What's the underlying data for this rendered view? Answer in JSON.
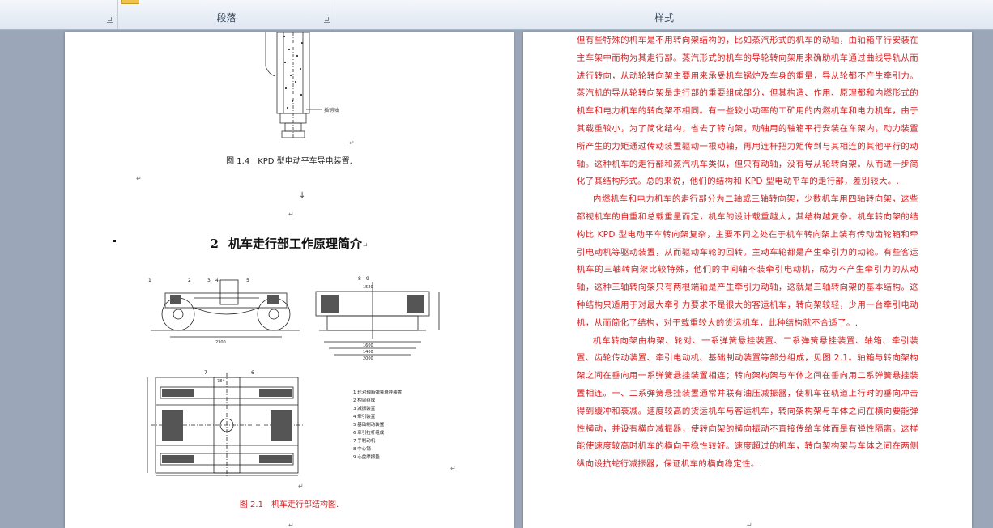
{
  "ribbon": {
    "paragraph_group": "段落",
    "styles_group": "样式"
  },
  "left_page": {
    "fig14_label": "插销轴",
    "fig14_caption": "图 1.4　KPD 型电动平车导电装置.",
    "heading_number": "2",
    "heading_text": "机车走行部工作原理简介",
    "fig21_caption": "图 2.1　机车走行部结构图.",
    "fig21_legend": [
      "1  轮对轴箱弹簧悬挂装置",
      "2  构架组成",
      "3  减振装置",
      "4  牵引装置",
      "5  基础制动装置",
      "6  牵引拉杆组成",
      "7  手制动机",
      "8  中心销",
      "9  心盘摩擦垫"
    ],
    "fig21_numbers": [
      "1",
      "2",
      "3",
      "4",
      "5",
      "7",
      "6",
      "8",
      "9"
    ],
    "fig21_dimensions": [
      "2300",
      "1520",
      "1600",
      "2000",
      "784",
      "1400"
    ]
  },
  "right_page": {
    "paragraphs": [
      "但有些特殊的机车是不用转向架结构的，比如蒸汽形式的机车的动轴，由轴箱平行安装在主车架中而构为其走行部。蒸汽形式的机车的导轮转向架用来确助机车通过曲线导轨从而进行转向，从动轮转向架主要用来承受机车锅炉及车身的重量，导从轮都不产生牵引力。蒸汽机的导从轮转向架是走行部的重要组成部分，但其构造、作用、原理都和内燃形式的机车和电力机车的转向架不相同。有一些较小功率的工矿用的内燃机车和电力机车，由于其载重较小，为了简化结构，省去了转向架，动轴用的轴箱平行安装在车架内，动力装置所产生的力矩通过传动装置驱动一根动轴，再用连杆把力矩传到与其相连的其他平行的动轴。这种机车的走行部和蒸汽机车类似，但只有动轴，没有导从轮转向架。从而进一步简化了其结构形式。总的来说，他们的结构和 KPD 型电动平车的走行部，差别较大。.",
      "内燃机车和电力机车的走行部分为二轴或三轴转向架，少数机车用四轴转向架，这些都视机车的自重和总载重量而定，机车的设计载重越大，其结构越复杂。机车转向架的结构比 KPD 型电动平车转向架复杂，主要不同之处在于机车转向架上装有传动齿轮箱和牵引电动机等驱动装置，从而驱动车轮的回转。主动车轮都是产生牵引力的动轮。有些客运机车的三轴转向架比较特殊，他们的中间轴不装牵引电动机，成为不产生牵引力的从动轴，这种三轴转向架只有两根端轴是产生牵引力动轴，这就是三轴转向架的基本结构。这种结构只适用于对最大牵引力要求不是很大的客运机车，转向架较轻，少用一台牵引电动机，从而简化了结构，对于载重较大的货运机车，此种结构就不合适了。.",
      "机车转向架由构架、轮对、一系弹簧悬挂装置、二系弹簧悬挂装置、轴箱、牵引装置、齿轮传动装置、牵引电动机、基础制动装置等部分组成，见图 2.1。轴箱与转向架构架之间在垂向用一系弹簧悬挂装置相连；转向架构架与车体之间在垂向用二系弹簧悬挂装置相连。一、二系弹簧悬挂装置通常并联有油压减振器，使机车在轨道上行时的垂向冲击得到缓冲和衰减。速度较高的货运机车与客运机车，转向架构架与车体之间在横向要能弹性横动，并设有横向减振器，使转向架的横向振动不直接传给车体而是有弹性隔离。这样能使速度较高时机车的横向平稳性较好。速度超过的机车，转向架构架与车体之间在两侧纵向设抗蛇行减振器，保证机车的横向稳定性。."
    ]
  }
}
